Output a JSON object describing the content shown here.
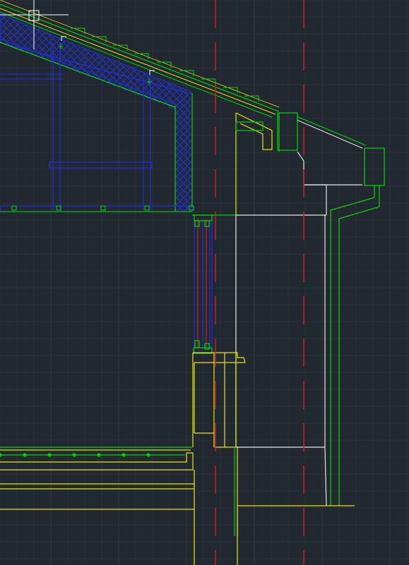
{
  "app": {
    "view": "cad-section-detail"
  },
  "colors": {
    "background": "#212830",
    "grid_major": "#2f3944",
    "grid_minor": "#262e37",
    "blue": "#1f2fd6",
    "yellow": "#e6e600",
    "green": "#00d600",
    "red": "#cc1f1f",
    "white": "#e6e6e6",
    "crosshair": "#ffffff"
  },
  "icons": {
    "crosshair": "crosshair-cursor-icon",
    "grip": "grip-marker-icon"
  }
}
